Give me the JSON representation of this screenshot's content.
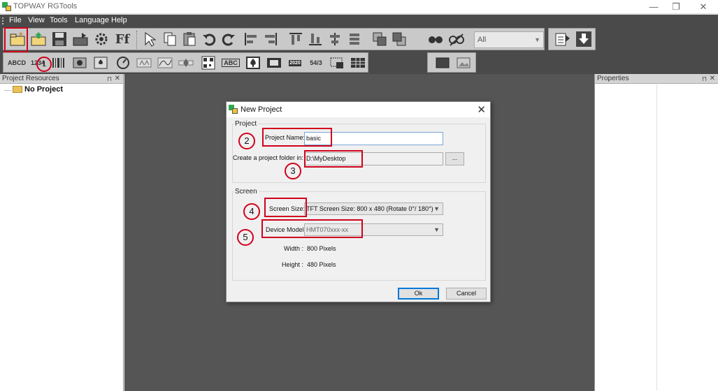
{
  "window": {
    "title": "TOPWAY RGTools",
    "minimize": "—",
    "restore": "❐",
    "close": "✕"
  },
  "menu": {
    "items": [
      "File",
      "View",
      "Tools",
      "Language",
      "Help"
    ]
  },
  "toolbar": {
    "filter_combo": {
      "value": "All"
    },
    "text_buttons": {
      "abcd": "ABCD",
      "num": "1234",
      "abc": "ABC",
      "date": "2020",
      "num_display": "54/3"
    }
  },
  "left_panel": {
    "title": "Project Resources",
    "pin": "⊓",
    "close": "✕",
    "tree_root": "No Project"
  },
  "right_panel": {
    "title": "Properties",
    "pin": "⊓",
    "close": "✕"
  },
  "dialog": {
    "title": "New Project",
    "close": "✕",
    "project_group": "Project",
    "project_name_label": "Project Name:",
    "project_name_value": "basic",
    "folder_label": "Create a project folder in:",
    "folder_value": "D:\\MyDesktop",
    "browse_label": "...",
    "screen_group": "Screen",
    "screen_size_label": "Screen Size:",
    "screen_size_value": "TFT Screen Size: 800 x 480 (Rotate 0°/ 180°)",
    "device_model_label": "Device Model:",
    "device_model_value": "HMT070xxx-xx",
    "width_label": "Width :",
    "width_value": "800 Pixels",
    "height_label": "Height :",
    "height_value": "480 Pixels",
    "ok_label": "Ok",
    "cancel_label": "Cancel"
  },
  "annotations": [
    "1",
    "2",
    "3",
    "4",
    "5"
  ],
  "colors": {
    "annotation_red": "#d0021b",
    "workspace": "#555555",
    "toolbar_bg": "#4a4a4a"
  }
}
